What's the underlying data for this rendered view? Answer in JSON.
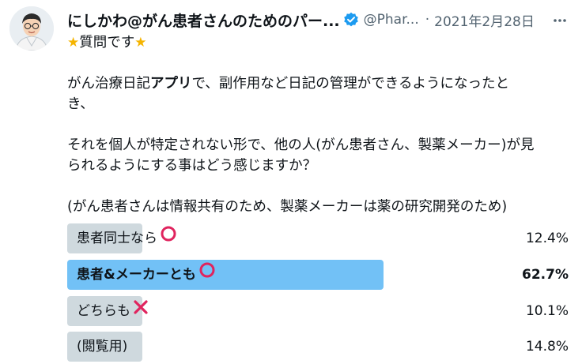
{
  "tweet": {
    "author_name": "にしかわ@がん患者さんのためのパー...",
    "handle": "@Phar...",
    "separator": "·",
    "date": "2021年2月28日",
    "verified_icon": "verified-badge-icon",
    "more_icon": "more-horizontal-icon",
    "text": {
      "heading": "質問です",
      "para1_a": "がん治療日記",
      "para1_b": "アプリ",
      "para1_c": "で、副作用など日記の管理ができるようになったと",
      "para1_d": "き、",
      "para2_a": "それを個人が特定されない形で、他の人(がん患者さん、製薬メーカー)が見",
      "para2_b": "られるようにする事はどう感じますか？",
      "para3": "(がん患者さんは情報共有のため、製薬メーカーは薬の研究開発のため)"
    }
  },
  "poll": {
    "options": [
      {
        "label": "患者同士なら",
        "mark": "circle-mark-icon",
        "percent_text": "12.4%",
        "percent": 12.4,
        "leading": false
      },
      {
        "label": "患者&メーカーとも",
        "mark": "circle-mark-icon",
        "percent_text": "62.7%",
        "percent": 62.7,
        "leading": true
      },
      {
        "label": "どちらも",
        "mark": "cross-mark-icon",
        "percent_text": "10.1%",
        "percent": 10.1,
        "leading": false
      },
      {
        "label": "(閲覧用)",
        "mark": "",
        "percent_text": "14.8%",
        "percent": 14.8,
        "leading": false
      }
    ]
  },
  "colors": {
    "leading_bar": "#72c1f6",
    "other_bar": "#cfd9de",
    "verified": "#1d9bf0",
    "circle_mark": "#e0245e",
    "cross_mark": "#e0245e",
    "star": "#f5b400"
  }
}
